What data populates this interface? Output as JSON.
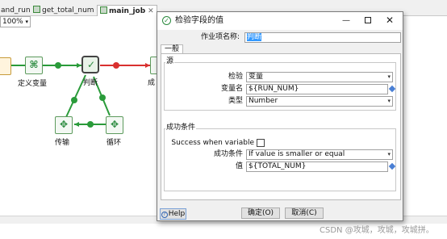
{
  "editor": {
    "tabs": [
      {
        "label": "and_run",
        "active": false
      },
      {
        "label": "get_total_num",
        "active": false
      },
      {
        "label": "main_job",
        "active": true,
        "close": "✕"
      }
    ],
    "zoom": "100%",
    "nodes": {
      "define_var": "定义变量",
      "judge": "判断",
      "success_partial": "成",
      "transfer": "传输",
      "loop": "循环"
    }
  },
  "dialog": {
    "title": "检验字段的值",
    "job_name_label": "作业项名称:",
    "job_name_value": "判断",
    "general_tab": "一般",
    "source_group": "源",
    "check_label": "检验",
    "check_value": "变量",
    "varname_label": "变量名",
    "varname_value": "${RUN_NUM}",
    "type_label": "类型",
    "type_value": "Number",
    "success_group": "成功条件",
    "success_when_label": "Success when variable",
    "success_when_checked": false,
    "condition_label": "成功条件",
    "condition_value": "If value is smaller or equal",
    "value_label": "值",
    "value_value": "${TOTAL_NUM}",
    "help_label": "Help",
    "ok_label": "确定(O)",
    "cancel_label": "取消(C)"
  },
  "watermark": "CSDN @攻城，攻城，攻城拼。",
  "colors": {
    "hop_green": "#2a9b3a",
    "hop_red": "#d9302f",
    "selection_blue": "#3399ff"
  }
}
